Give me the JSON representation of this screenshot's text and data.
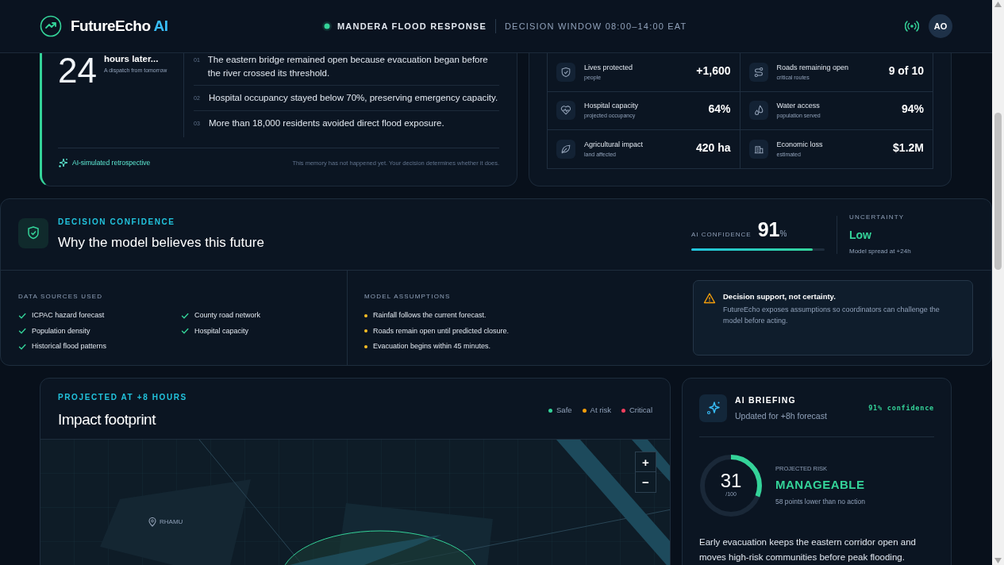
{
  "header": {
    "brand": "FutureEcho",
    "brand_suffix": "AI",
    "incident": "MANDERA FLOOD RESPONSE",
    "window": "DECISION WINDOW 08:00–14:00 EAT",
    "avatar": "AO"
  },
  "dispatch": {
    "number": "24",
    "title": "hours later...",
    "subtitle": "A dispatch from tomorrow",
    "items": [
      {
        "index": "01",
        "text": "The eastern bridge remained open because evacuation began before the river crossed its threshold."
      },
      {
        "index": "02",
        "text": "Hospital occupancy stayed below 70%, preserving emergency capacity."
      },
      {
        "index": "03",
        "text": "More than 18,000 residents avoided direct flood exposure."
      }
    ],
    "footer_label": "AI-simulated retrospective",
    "footer_note": "This memory has not happened yet. Your decision determines whether it does."
  },
  "outcomes": [
    {
      "label": "Lives protected",
      "sub": "people",
      "value": "+1,600"
    },
    {
      "label": "Roads remaining open",
      "sub": "critical routes",
      "value": "9 of 10"
    },
    {
      "label": "Hospital capacity",
      "sub": "projected occupancy",
      "value": "64%"
    },
    {
      "label": "Water access",
      "sub": "population served",
      "value": "94%"
    },
    {
      "label": "Agricultural impact",
      "sub": "land affected",
      "value": "420 ha"
    },
    {
      "label": "Economic loss",
      "sub": "estimated",
      "value": "$1.2M"
    }
  ],
  "confidence": {
    "eyebrow": "DECISION CONFIDENCE",
    "title": "Why the model believes this future",
    "ai_label": "AI CONFIDENCE",
    "value": "91",
    "unit": "%",
    "level": 0.91,
    "uncertainty_label": "UNCERTAINTY",
    "uncertainty": "Low",
    "uncertainty_note": "Model spread at +24h",
    "sources_title": "DATA SOURCES USED",
    "sources": [
      "ICPAC hazard forecast",
      "County road network",
      "Population density",
      "Hospital capacity",
      "Historical flood patterns"
    ],
    "assumptions_title": "MODEL ASSUMPTIONS",
    "assumptions": [
      "Rainfall follows the current forecast.",
      "Roads remain open until predicted closure.",
      "Evacuation begins within 45 minutes."
    ],
    "notice": {
      "title": "Decision support, not certainty.",
      "text": "FutureEcho exposes assumptions so coordinators can challenge the model before acting."
    }
  },
  "map": {
    "eyebrow": "PROJECTED AT +8 HOURS",
    "title": "Impact footprint",
    "legend": [
      {
        "label": "Safe",
        "color": "#34d399"
      },
      {
        "label": "At risk",
        "color": "#f59e0b"
      },
      {
        "label": "Critical",
        "color": "#f43f5e"
      }
    ],
    "place": "RHAMU",
    "zoom_in": "+",
    "zoom_out": "−"
  },
  "briefing": {
    "title": "AI BRIEFING",
    "subtitle": "Updated for +8h forecast",
    "confidence": "91% confidence",
    "score": "31",
    "score_max": "/100",
    "level": 0.31,
    "risk_label": "PROJECTED RISK",
    "risk": "MANAGEABLE",
    "risk_note": "58 points lower than no action",
    "summary": "Early evacuation keeps the eastern corridor open and moves high-risk communities before peak flooding."
  }
}
